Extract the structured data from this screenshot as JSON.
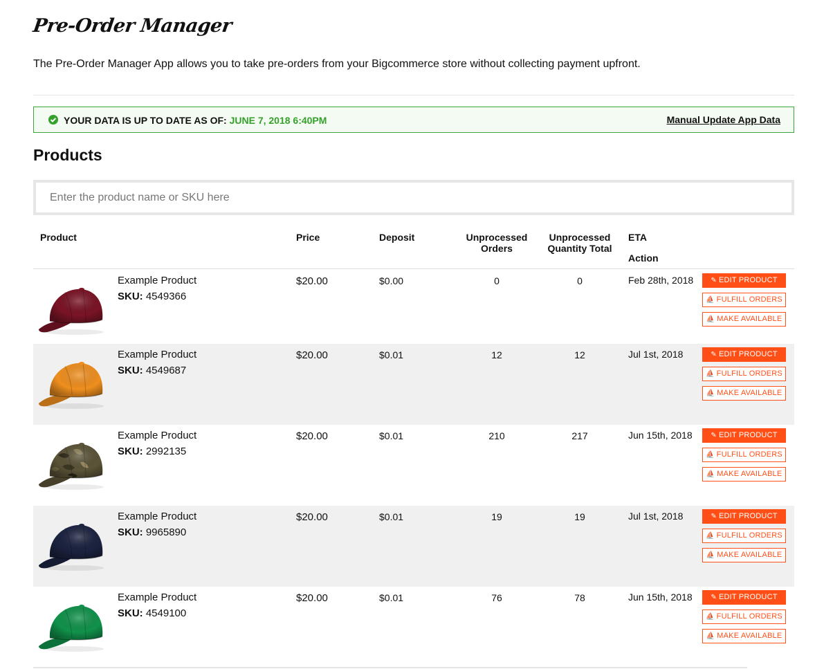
{
  "app": {
    "title": "Pre-Order Manager",
    "description": "The Pre-Order Manager App allows you to take pre-orders from your Bigcommerce store without collecting payment upfront."
  },
  "status": {
    "label": "YOUR DATA IS UP TO DATE AS OF:",
    "date": "JUNE 7, 2018 6:40PM",
    "manual_update": "Manual Update App Data",
    "color": "#34a12b"
  },
  "products_section": {
    "title": "Products",
    "search_placeholder": "Enter the product name or SKU here"
  },
  "table": {
    "headers": {
      "product": "Product",
      "price": "Price",
      "deposit": "Deposit",
      "unprocessed_orders_1": "Unprocessed",
      "unprocessed_orders_2": "Orders",
      "unprocessed_qty_1": "Unprocessed",
      "unprocessed_qty_2": "Quantity Total",
      "eta": "ETA",
      "action": "Action"
    },
    "sku_label": "SKU:",
    "buttons": {
      "edit": "EDIT PRODUCT",
      "fulfill": "FULFILL ORDERS",
      "available": "MAKE AVAILABLE"
    },
    "rows": [
      {
        "name": "Example Product",
        "sku": "4549366",
        "price": "$20.00",
        "deposit": "$0.00",
        "orders": "0",
        "qty": "0",
        "eta": "Feb 28th, 2018",
        "cap_color": "#7a1426",
        "cap_icon": "cap-icon"
      },
      {
        "name": "Example Product",
        "sku": "4549687",
        "price": "$20.00",
        "deposit": "$0.01",
        "orders": "12",
        "qty": "12",
        "eta": "Jul 1st, 2018",
        "cap_color": "#ef8f1f",
        "cap_icon": "cap-icon"
      },
      {
        "name": "Example Product",
        "sku": "2992135",
        "price": "$20.00",
        "deposit": "$0.01",
        "orders": "210",
        "qty": "217",
        "eta": "Jun 15th, 2018",
        "cap_color": "#5b5438",
        "cap_icon": "camo-cap-icon"
      },
      {
        "name": "Example Product",
        "sku": "9965890",
        "price": "$20.00",
        "deposit": "$0.01",
        "orders": "19",
        "qty": "19",
        "eta": "Jul 1st, 2018",
        "cap_color": "#1c2340",
        "cap_icon": "cap-icon"
      },
      {
        "name": "Example Product",
        "sku": "4549100",
        "price": "$20.00",
        "deposit": "$0.01",
        "orders": "76",
        "qty": "78",
        "eta": "Jun 15th, 2018",
        "cap_color": "#11924a",
        "cap_icon": "cap-icon"
      }
    ]
  },
  "colors": {
    "accent": "#ff4f16",
    "alt_row": "#f0f0f0",
    "status_border": "#3aa53a"
  }
}
